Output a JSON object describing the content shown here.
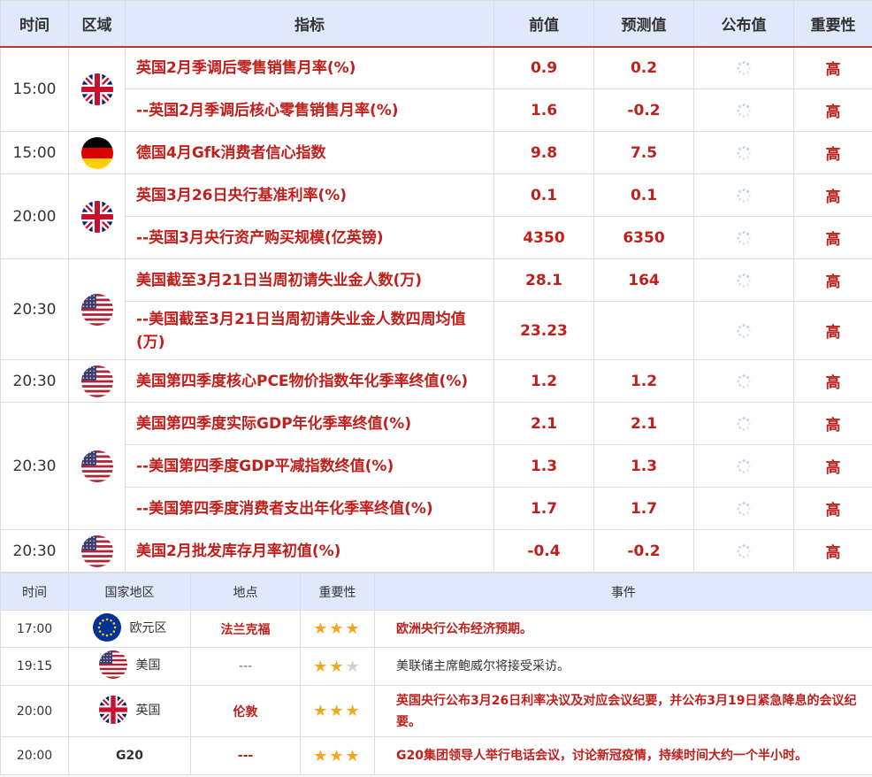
{
  "main_table": {
    "headers": [
      "时间",
      "区域",
      "指标",
      "前值",
      "预测值",
      "公布值",
      "重要性"
    ],
    "rows": [
      {
        "time": "15:00",
        "flag": "uk-flag-icon",
        "indicator": "英国2月季调后零售销售月率(%)",
        "prev": "0.9",
        "forecast": "0.2",
        "importance": "高"
      },
      {
        "indicator": "--英国2月季调后核心零售销售月率(%)",
        "prev": "1.6",
        "forecast": "-0.2",
        "importance": "高"
      },
      {
        "time": "15:00",
        "flag": "germany-flag-icon",
        "indicator": "德国4月Gfk消费者信心指数",
        "prev": "9.8",
        "forecast": "7.5",
        "importance": "高"
      },
      {
        "time": "20:00",
        "flag": "uk-flag-icon",
        "indicator": "英国3月26日央行基准利率(%)",
        "prev": "0.1",
        "forecast": "0.1",
        "importance": "高"
      },
      {
        "indicator": "--英国3月央行资产购买规模(亿英镑)",
        "prev": "4350",
        "forecast": "6350",
        "importance": "高"
      },
      {
        "time": "20:30",
        "flag": "us-flag-icon",
        "indicator": "美国截至3月21日当周初请失业金人数(万)",
        "prev": "28.1",
        "forecast": "164",
        "importance": "高"
      },
      {
        "indicator": "--美国截至3月21日当周初请失业金人数四周均值(万)",
        "prev": "23.23",
        "forecast": "",
        "importance": "高"
      },
      {
        "time": "20:30",
        "flag": "us-flag-icon",
        "indicator": "美国第四季度核心PCE物价指数年化季率终值(%)",
        "prev": "1.2",
        "forecast": "1.2",
        "importance": "高"
      },
      {
        "time": "20:30",
        "flag": "us-flag-icon",
        "indicator": "美国第四季度实际GDP年化季率终值(%)",
        "prev": "2.1",
        "forecast": "2.1",
        "importance": "高"
      },
      {
        "indicator": "--美国第四季度GDP平减指数终值(%)",
        "prev": "1.3",
        "forecast": "1.3",
        "importance": "高"
      },
      {
        "indicator": "--美国第四季度消费者支出年化季率终值(%)",
        "prev": "1.7",
        "forecast": "1.7",
        "importance": "高"
      },
      {
        "time": "20:30",
        "flag": "us-flag-icon",
        "indicator": "美国2月批发库存月率初值(%)",
        "prev": "-0.4",
        "forecast": "-0.2",
        "importance": "高"
      }
    ]
  },
  "events_table": {
    "headers": [
      "时间",
      "国家地区",
      "地点",
      "重要性",
      "事件"
    ],
    "rows": [
      {
        "time": "17:00",
        "flag": "eu-flag-icon",
        "country": "欧元区",
        "place": "法兰克福",
        "stars": 3,
        "event": "欧洲央行公布经济预期。"
      },
      {
        "time": "19:15",
        "flag": "us-flag-icon",
        "country": "美国",
        "place": "---",
        "stars": 2,
        "event": "美联储主席鲍威尔将接受采访。"
      },
      {
        "time": "20:00",
        "flag": "uk-flag-icon",
        "country": "英国",
        "place": "伦敦",
        "stars": 3,
        "event": "英国央行公布3月26日利率决议及对应会议纪要，并公布3月19日紧急降息的会议纪要。"
      },
      {
        "time": "20:00",
        "flag": "",
        "country": "G20",
        "place": "---",
        "stars": 3,
        "event": "G20集团领导人举行电话会议，讨论新冠疫情，持续时间大约一个半小时。"
      }
    ]
  },
  "colors": {
    "accent_red": "#c0201b",
    "header_bg": "#dfe9fa",
    "star": "#f5a623"
  }
}
